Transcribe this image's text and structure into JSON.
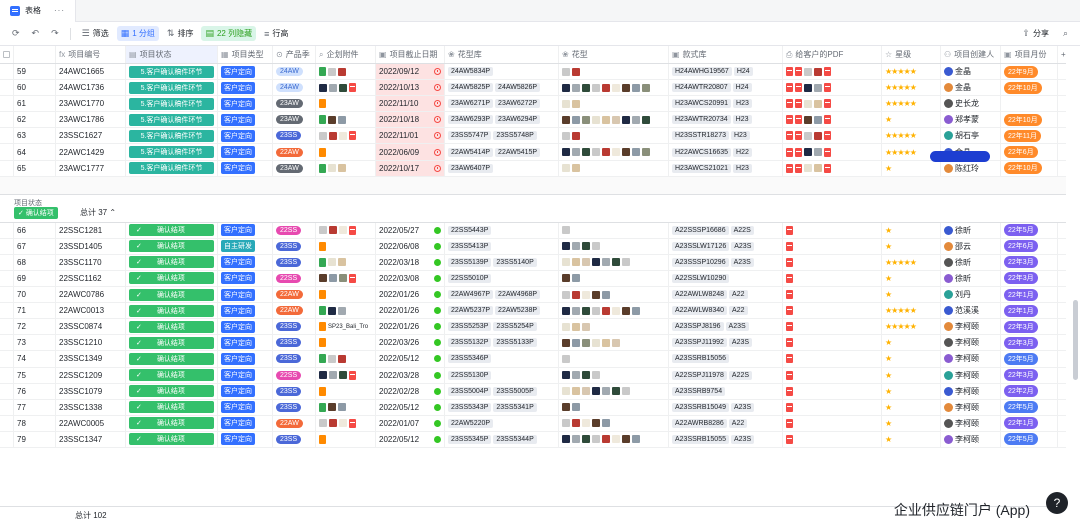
{
  "tab": {
    "title": "表格"
  },
  "toolbar": {
    "filter": "筛选",
    "group": "1 分组",
    "sort": "排序",
    "hidden": "22 列隐藏",
    "rowheight": "行高",
    "share": "分享"
  },
  "headers": [
    "项目编号",
    "项目状态",
    "项目类型",
    "产品季",
    "企划附件",
    "项目截止日期",
    "花型库",
    "花型",
    "款式库",
    "给客户的PDF",
    "星级",
    "项目创建人",
    "项目月份"
  ],
  "colors": {
    "accent": "#3370ff",
    "status_teal": "#2bb5a0",
    "status_green": "#34c06b",
    "month_orange": "#ff8a2a"
  },
  "group1": [
    {
      "n": "59",
      "code": "24AWC1665",
      "status": "5.客户确认稿件环节",
      "type": "客户定向",
      "season": "24AW",
      "date": "2022/09/12",
      "lib": [
        "24AW5834P"
      ],
      "style": [
        "H24AWHG19567",
        "H24"
      ],
      "stars": "★★★★★",
      "creator": "金晶",
      "month": "22年9月"
    },
    {
      "n": "60",
      "code": "24AWC1736",
      "status": "5.客户确认稿件环节",
      "type": "客户定向",
      "season": "24AW",
      "date": "2022/10/13",
      "lib": [
        "24AW5825P",
        "24AW5826P"
      ],
      "style": [
        "H24AWTR20807",
        "H24"
      ],
      "stars": "★★★★★",
      "creator": "金晶",
      "month": "22年10月"
    },
    {
      "n": "61",
      "code": "23AWC1770",
      "status": "5.客户确认稿件环节",
      "type": "客户定向",
      "season": "23AW",
      "date": "2022/11/10",
      "lib": [
        "23AW6271P",
        "23AW6272P"
      ],
      "style": [
        "H23AWCS20991",
        "H23"
      ],
      "stars": "★★★★★",
      "creator": "史长龙",
      "month": ""
    },
    {
      "n": "62",
      "code": "23AWC1786",
      "status": "5.客户确认稿件环节",
      "type": "客户定向",
      "season": "23AW",
      "date": "2022/10/18",
      "lib": [
        "23AW6293P",
        "23AW6294P"
      ],
      "style": [
        "H23AWTR20734",
        "H23"
      ],
      "stars": "★",
      "creator": "郑孝蒙",
      "month": "22年10月"
    },
    {
      "n": "63",
      "code": "23SSC1627",
      "status": "5.客户确认稿件环节",
      "type": "客户定向",
      "season": "23SS",
      "date": "2022/11/01",
      "lib": [
        "23SS5747P",
        "23SS5748P"
      ],
      "style": [
        "H23SSTR18273",
        "H23"
      ],
      "stars": "★★★★★",
      "creator": "胡石亭",
      "month": "22年11月"
    },
    {
      "n": "64",
      "code": "22AWC1429",
      "status": "5.客户确认稿件环节",
      "type": "客户定向",
      "season": "22AW",
      "date": "2022/06/09",
      "lib": [
        "22AW5414P",
        "22AW5415P"
      ],
      "style": [
        "H22AWCS16635",
        "H22"
      ],
      "stars": "★★★★★",
      "creator": "金晶",
      "month": "22年6月"
    },
    {
      "n": "65",
      "code": "23AWC1777",
      "status": "5.客户确认稿件环节",
      "type": "客户定向",
      "season": "23AW",
      "date": "2022/10/17",
      "lib": [
        "23AW6407P"
      ],
      "style": [
        "H23AWCS21021",
        "H23"
      ],
      "stars": "★",
      "creator": "陈红玲",
      "month": "22年10月"
    }
  ],
  "group2": {
    "label": "项目状态",
    "tag": "确认结项",
    "total": "总计 37",
    "rows": [
      {
        "n": "66",
        "code": "22SSC1281",
        "type": "客户定向",
        "season": "22SS",
        "date": "2022/05/27",
        "lib": [
          "22SS5443P"
        ],
        "style": [
          "A22SSSP16686",
          "A22S"
        ],
        "stars": "★",
        "creator": "徐昕",
        "month": "22年5月",
        "mc": "p"
      },
      {
        "n": "67",
        "code": "23SSD1405",
        "type": "自主研发",
        "season": "23SS",
        "date": "2022/06/08",
        "lib": [
          "23SS5413P"
        ],
        "style": [
          "A23SSLW17126",
          "A23S"
        ],
        "stars": "★",
        "creator": "邵云",
        "month": "22年6月",
        "mc": "p"
      },
      {
        "n": "68",
        "code": "23SSC1170",
        "type": "客户定向",
        "season": "23SS",
        "date": "2022/03/18",
        "lib": [
          "23SS5139P",
          "23SS5140P"
        ],
        "style": [
          "A23SSSP10296",
          "A23S"
        ],
        "stars": "★★★★★",
        "creator": "徐昕",
        "month": "22年3月",
        "mc": "p"
      },
      {
        "n": "69",
        "code": "22SSC1162",
        "type": "客户定向",
        "season": "22SS",
        "date": "2022/03/08",
        "lib": [
          "22SS5010P"
        ],
        "style": [
          "A22SSLW10290"
        ],
        "stars": "★",
        "creator": "徐昕",
        "month": "22年3月",
        "mc": "p"
      },
      {
        "n": "70",
        "code": "22AWC0786",
        "type": "客户定向",
        "season": "22AW",
        "date": "2022/01/26",
        "lib": [
          "22AW4967P",
          "22AW4968P"
        ],
        "style": [
          "A22AWLW8248",
          "A22"
        ],
        "stars": "★",
        "creator": "刘丹",
        "month": "22年1月",
        "mc": "p"
      },
      {
        "n": "71",
        "code": "22AWC0013",
        "type": "客户定向",
        "season": "22AW",
        "date": "2022/01/26",
        "lib": [
          "22AW5237P",
          "22AW5238P"
        ],
        "style": [
          "A22AWLW8340",
          "A22"
        ],
        "stars": "★★★★★",
        "creator": "范溪溪",
        "month": "22年1月",
        "mc": "p"
      },
      {
        "n": "72",
        "code": "23SSC0874",
        "type": "客户定向",
        "season": "23SS",
        "date": "2022/01/26",
        "lib": [
          "23SS5253P",
          "23SS5254P"
        ],
        "style": [
          "A23SSPJ8196",
          "A23S"
        ],
        "stars": "★★★★★",
        "creator": "李柯颐",
        "month": "22年3月",
        "mc": "p"
      },
      {
        "n": "73",
        "code": "23SSC1210",
        "type": "客户定向",
        "season": "23SS",
        "date": "2022/03/26",
        "lib": [
          "23SS5132P",
          "23SS5133P"
        ],
        "style": [
          "A23SSPJ11992",
          "A23S"
        ],
        "stars": "★",
        "creator": "李柯颐",
        "month": "22年3月",
        "mc": "p"
      },
      {
        "n": "74",
        "code": "23SSC1349",
        "type": "客户定向",
        "season": "23SS",
        "date": "2022/05/12",
        "lib": [
          "23SS5346P"
        ],
        "style": [
          "A23SSRB15056"
        ],
        "stars": "★",
        "creator": "李柯颐",
        "month": "22年5月",
        "mc": "b"
      },
      {
        "n": "75",
        "code": "22SSC1209",
        "type": "客户定向",
        "season": "22SS",
        "date": "2022/03/28",
        "lib": [
          "22SS5130P"
        ],
        "style": [
          "A22SSPJ11978",
          "A22S"
        ],
        "stars": "★",
        "creator": "李柯颐",
        "month": "22年3月",
        "mc": "p"
      },
      {
        "n": "76",
        "code": "23SSC1079",
        "type": "客户定向",
        "season": "23SS",
        "date": "2022/02/28",
        "lib": [
          "23SS5004P",
          "23SS5005P"
        ],
        "style": [
          "A23SSRB9754"
        ],
        "stars": "★",
        "creator": "李柯颐",
        "month": "22年2月",
        "mc": "p"
      },
      {
        "n": "77",
        "code": "23SSC1338",
        "type": "客户定向",
        "season": "23SS",
        "date": "2022/05/12",
        "lib": [
          "23SS5343P",
          "23SS5341P"
        ],
        "style": [
          "A23SSRB15049",
          "A23S"
        ],
        "stars": "★",
        "creator": "李柯颐",
        "month": "22年5月",
        "mc": "b"
      },
      {
        "n": "78",
        "code": "22AWC0005",
        "type": "客户定向",
        "season": "22AW",
        "date": "2022/01/07",
        "lib": [
          "22AW5220P"
        ],
        "style": [
          "A22AWRB8286",
          "A22"
        ],
        "stars": "★",
        "creator": "李柯颐",
        "month": "22年1月",
        "mc": "p"
      },
      {
        "n": "79",
        "code": "23SSC1347",
        "type": "客户定向",
        "season": "23SS",
        "date": "2022/05/12",
        "lib": [
          "23SS5345P",
          "23SS5344P"
        ],
        "style": [
          "A23SSRB15055",
          "A23S"
        ],
        "stars": "★",
        "creator": "李柯颐",
        "month": "22年5月",
        "mc": "b"
      }
    ],
    "status": "确认结项"
  },
  "footer": {
    "total": "总计 102"
  },
  "brand": "企业供应链门户 (App)",
  "attach": {
    "r72": "SP23_Bali_Tro"
  }
}
